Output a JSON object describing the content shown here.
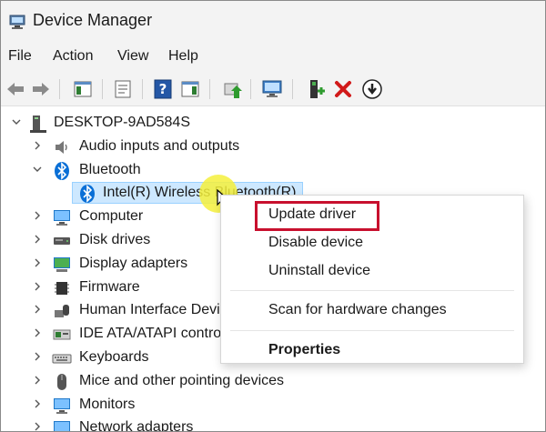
{
  "window": {
    "title": "Device Manager"
  },
  "menubar": {
    "items": [
      "File",
      "Action",
      "View",
      "Help"
    ]
  },
  "tree": {
    "root": "DESKTOP-9AD584S",
    "items": [
      {
        "label": "Audio inputs and outputs",
        "icon": "speaker-icon",
        "expanded": false
      },
      {
        "label": "Bluetooth",
        "icon": "bluetooth-icon",
        "expanded": true
      },
      {
        "label": "Intel(R) Wireless Bluetooth(R)",
        "icon": "bluetooth-icon",
        "child": true,
        "selected": true
      },
      {
        "label": "Computer",
        "icon": "computer-icon",
        "expanded": false
      },
      {
        "label": "Disk drives",
        "icon": "disk-icon",
        "expanded": false
      },
      {
        "label": "Display adapters",
        "icon": "display-adapter-icon",
        "expanded": false
      },
      {
        "label": "Firmware",
        "icon": "firmware-icon",
        "expanded": false
      },
      {
        "label": "Human Interface Devices",
        "icon": "hid-icon",
        "expanded": false
      },
      {
        "label": "IDE ATA/ATAPI controllers",
        "icon": "ide-icon",
        "expanded": false
      },
      {
        "label": "Keyboards",
        "icon": "keyboard-icon",
        "expanded": false
      },
      {
        "label": "Mice and other pointing devices",
        "icon": "mouse-icon",
        "expanded": false
      },
      {
        "label": "Monitors",
        "icon": "monitor-icon",
        "expanded": false
      },
      {
        "label": "Network adapters",
        "icon": "network-icon",
        "expanded": false
      }
    ]
  },
  "context_menu": {
    "update_driver": "Update driver",
    "disable_device": "Disable device",
    "uninstall_device": "Uninstall device",
    "scan_hardware": "Scan for hardware changes",
    "properties": "Properties"
  },
  "colors": {
    "highlight": "#c8102e",
    "selection": "#cde8ff",
    "bluetooth": "#0a6fd6",
    "remove": "#d11a1a"
  }
}
